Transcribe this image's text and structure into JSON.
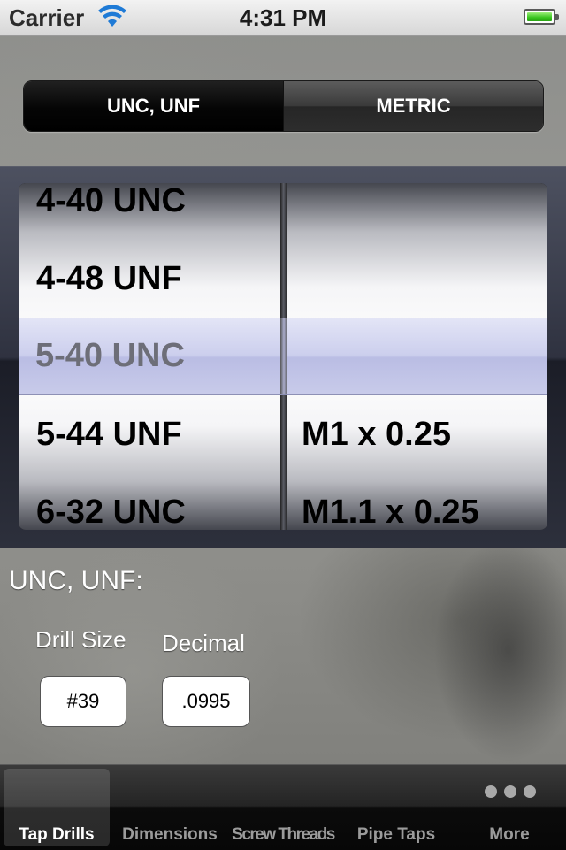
{
  "status_bar": {
    "carrier": "Carrier",
    "time": "4:31 PM",
    "wifi_icon": "wifi-icon",
    "battery_icon": "battery-icon"
  },
  "segmented": {
    "options": [
      "UNC, UNF",
      "METRIC"
    ],
    "selected_index": 0
  },
  "picker": {
    "left_column": [
      "4-40 UNC",
      "4-48 UNF",
      "5-40 UNC",
      "5-44 UNF",
      "6-32 UNC"
    ],
    "right_column": [
      "",
      "",
      "",
      "M1 x 0.25",
      "M1.1 x 0.25"
    ],
    "selected_row_index": 2
  },
  "results": {
    "title": "UNC, UNF:",
    "drill_size_label": "Drill Size",
    "decimal_label": "Decimal",
    "drill_size_value": "#39",
    "decimal_value": ".0995"
  },
  "tabbar": {
    "tabs": [
      "Tap Drills",
      "Dimensions",
      "Screw Threads",
      "Pipe Taps",
      "More"
    ],
    "selected_index": 0,
    "more_icon": "ellipsis-icon"
  },
  "colors": {
    "selection_tint": "#a6aadf",
    "tab_active": "#ffffff",
    "tab_inactive": "#9b9b9b"
  }
}
